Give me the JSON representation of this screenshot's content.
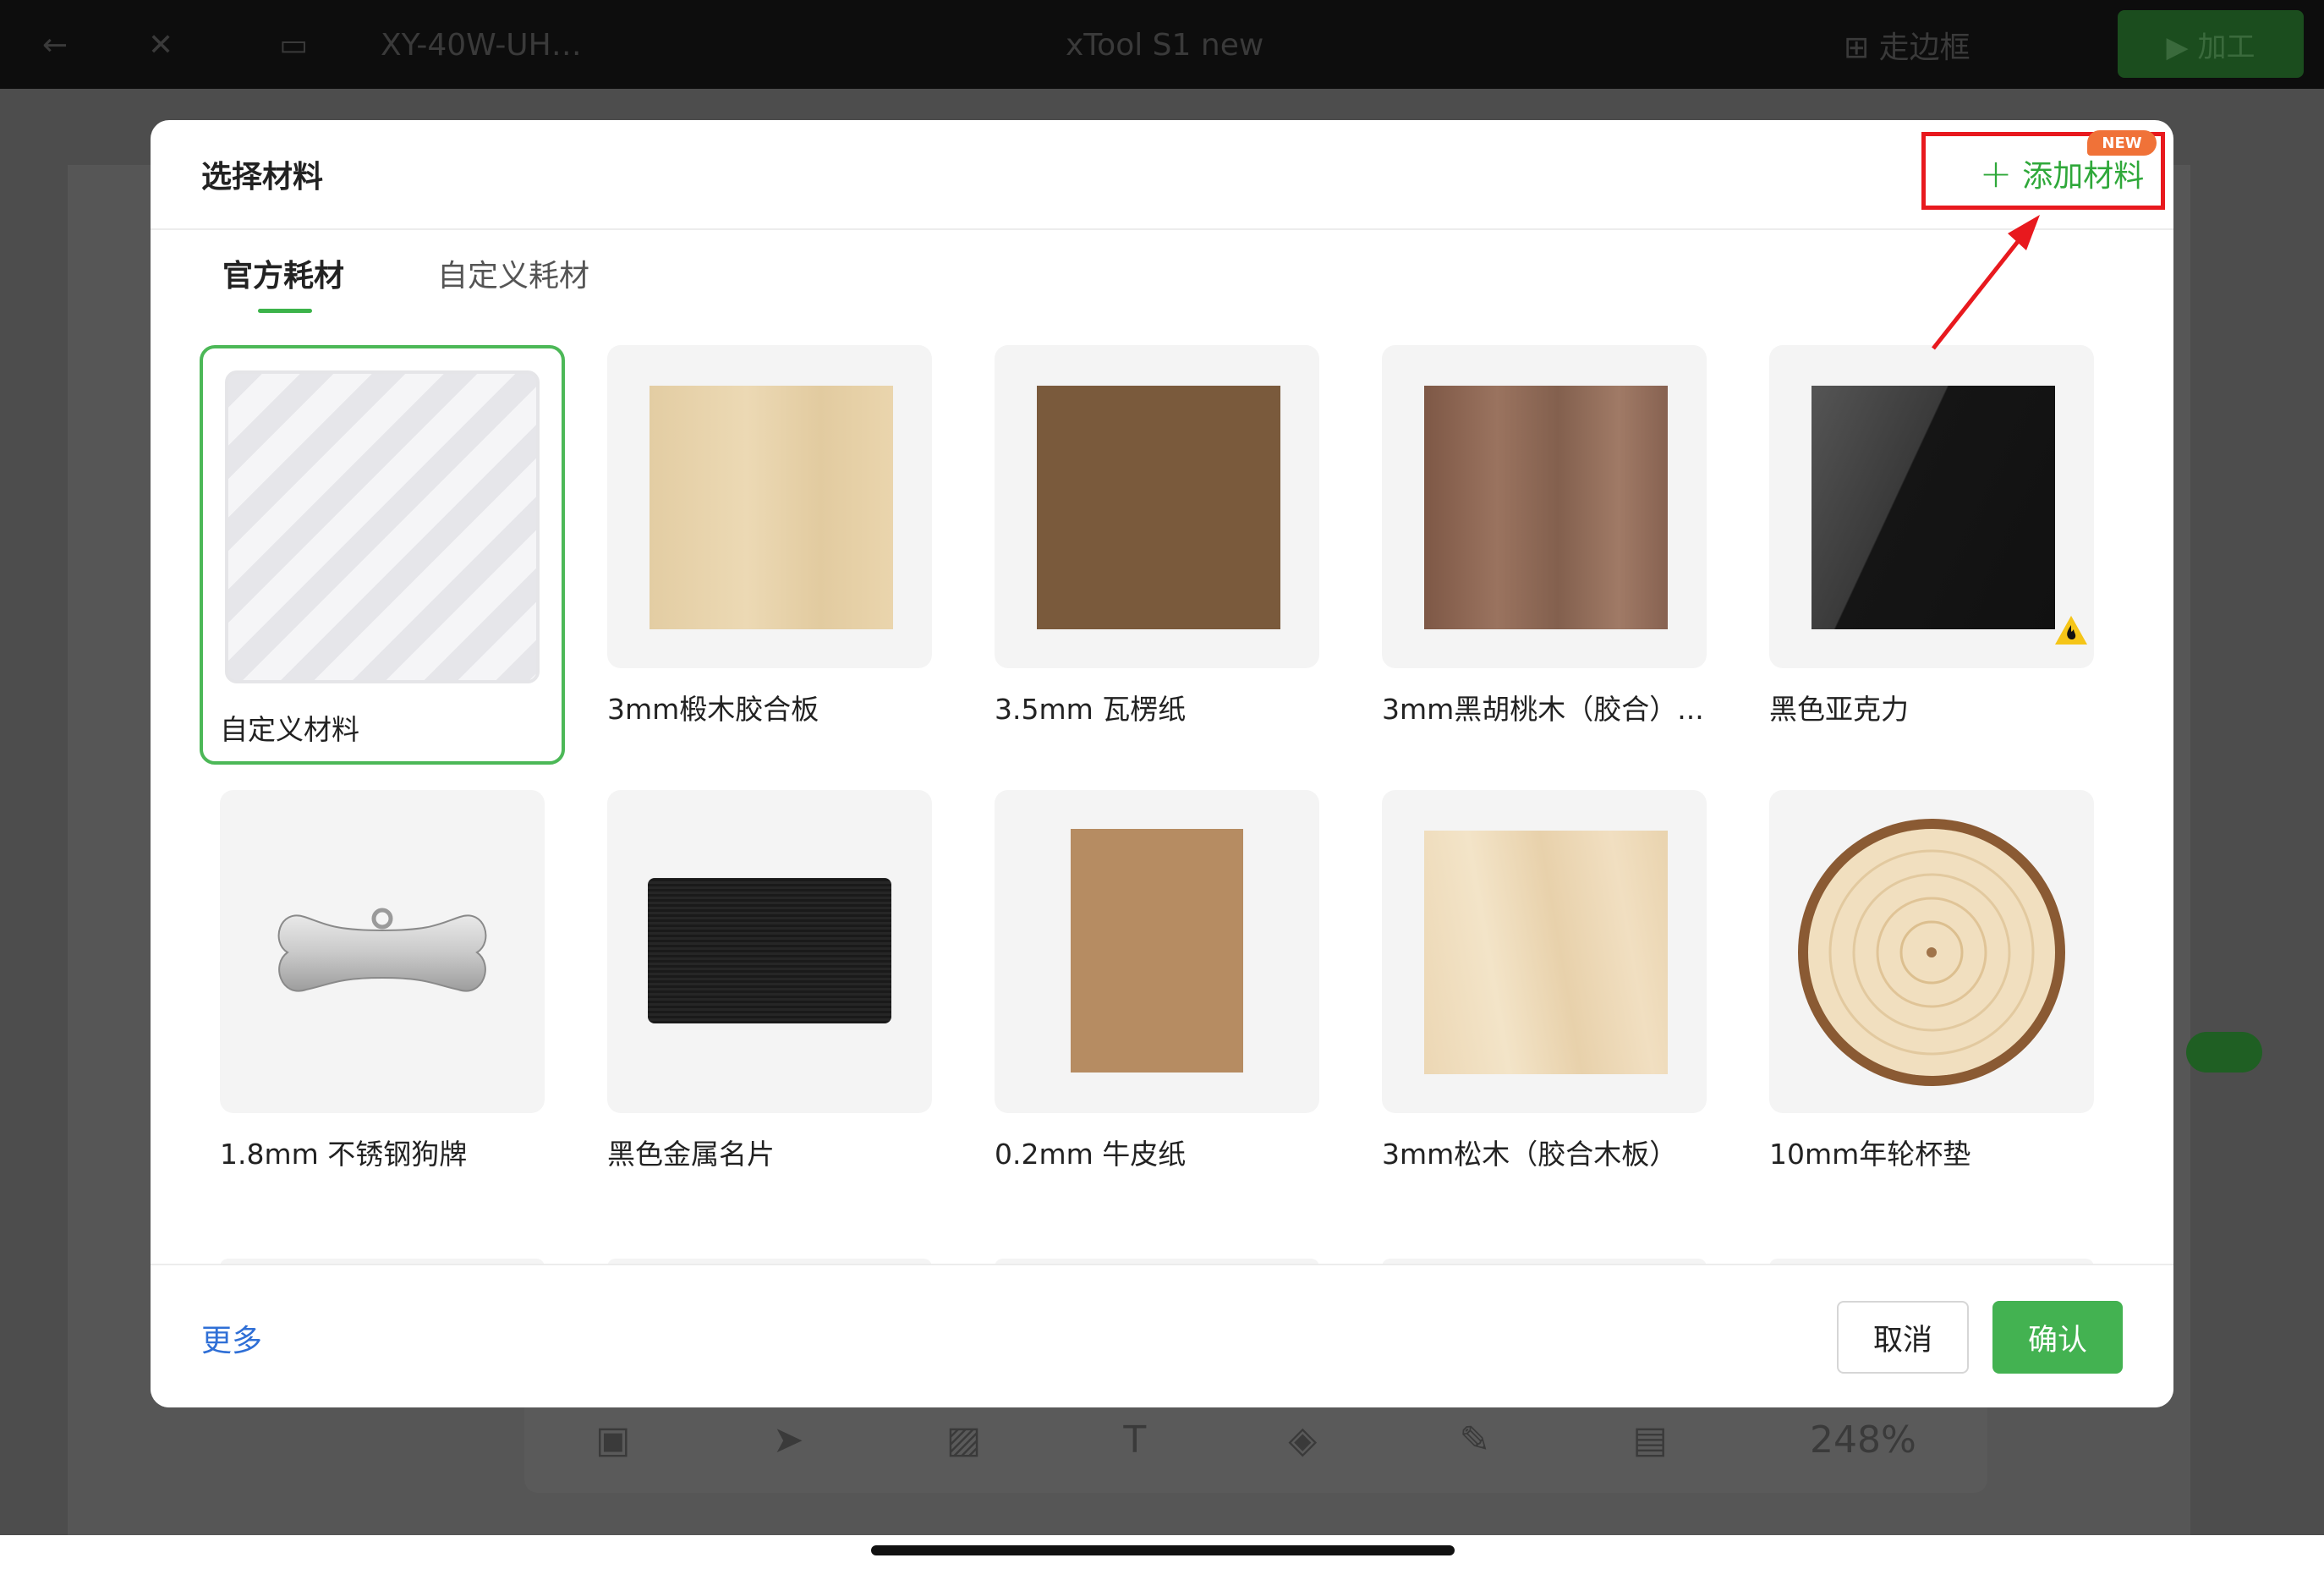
{
  "background_app": {
    "topbar_items": [
      "←",
      "✕",
      "▭",
      "XY-40W-UH…",
      "xTool S1 new",
      "⊞ 走边框"
    ],
    "run_label": "▶ 加工",
    "zoom": "248%"
  },
  "modal": {
    "title": "选择材料",
    "add_material": {
      "plus": "+",
      "label": "添加材料",
      "badge": "NEW"
    },
    "tabs": [
      {
        "label": "官方耗材",
        "active": true
      },
      {
        "label": "自定义耗材",
        "active": false
      }
    ],
    "materials": [
      {
        "label": "自定义材料",
        "swatch": "pattern",
        "selected": true
      },
      {
        "label": "3mm椴木胶合板",
        "swatch": "#e7d3ab"
      },
      {
        "label": "3.5mm 瓦楞纸",
        "swatch": "#7a5a3c"
      },
      {
        "label": "3mm黑胡桃木（胶合）...",
        "swatch": "#8a6452"
      },
      {
        "label": "黑色亚克力",
        "swatch": "#1c1c1c",
        "warning": true
      },
      {
        "label": "1.8mm 不锈钢狗牌",
        "swatch": "bone"
      },
      {
        "label": "黑色金属名片",
        "swatch": "#151515"
      },
      {
        "label": "0.2mm 牛皮纸",
        "swatch": "#b68c62"
      },
      {
        "label": "3mm松木（胶合木板）",
        "swatch": "#ecd8b8"
      },
      {
        "label": "10mm年轮杯垫",
        "swatch": "wood-slice"
      }
    ],
    "footer": {
      "more": "更多",
      "cancel": "取消",
      "confirm": "确认"
    }
  },
  "colors": {
    "accent_green": "#43b251",
    "highlight_red": "#e8191e",
    "link_blue": "#2f6fd6",
    "badge_orange": "#f07238"
  }
}
